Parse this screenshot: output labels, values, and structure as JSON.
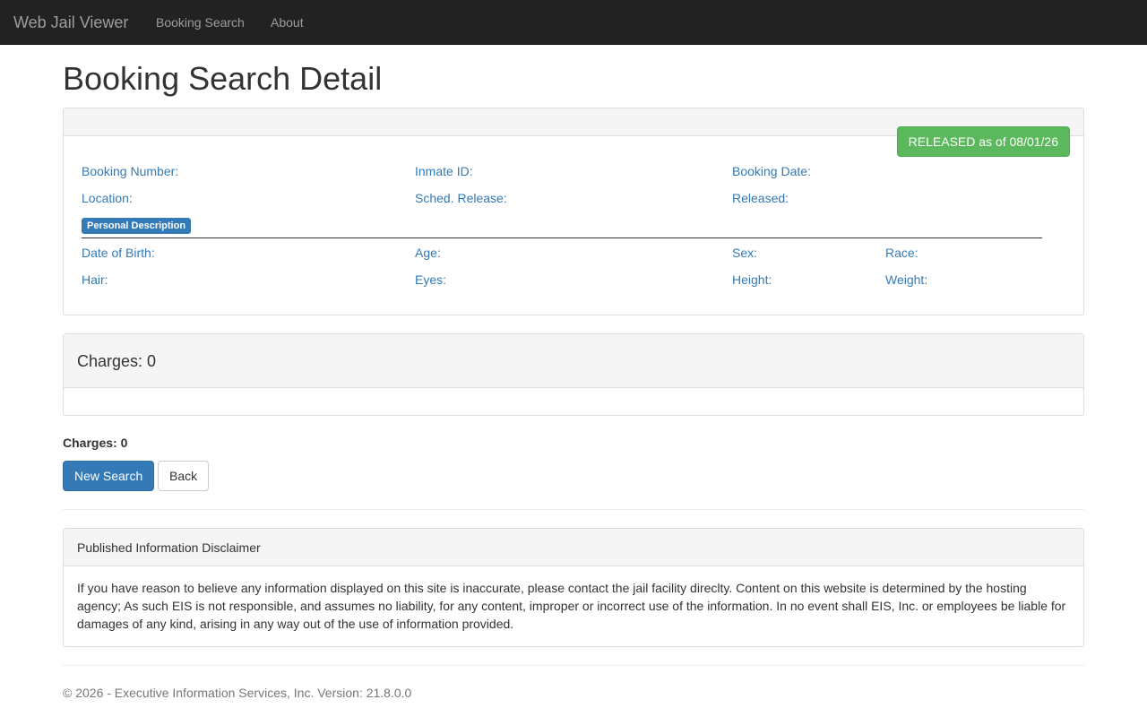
{
  "navbar": {
    "brand": "Web Jail Viewer",
    "links": [
      "Booking Search",
      "About"
    ]
  },
  "page": {
    "title": "Booking Search Detail"
  },
  "booking": {
    "status": "RELEASED as of 08/01/26",
    "status_color": "#5cb85c",
    "fields": {
      "booking_number": "Booking Number:",
      "inmate_id": "Inmate ID:",
      "booking_date": "Booking Date:",
      "location": "Location:",
      "sched_release": "Sched. Release:",
      "released": "Released:"
    },
    "personal_description_badge": "Personal Description",
    "personal": {
      "dob": "Date of Birth:",
      "age": "Age:",
      "sex": "Sex:",
      "race": "Race:",
      "hair": "Hair:",
      "eyes": "Eyes:",
      "height": "Height:",
      "weight": "Weight:"
    }
  },
  "charges": {
    "panel_heading": "Charges: 0",
    "summary": "Charges: 0"
  },
  "actions": {
    "new_search": "New Search",
    "back": "Back"
  },
  "disclaimer": {
    "title": "Published Information Disclaimer",
    "body": "If you have reason to believe any information displayed on this site is inaccurate, please contact the jail facility direclty. Content on this website is determined by the hosting agency; As such EIS is not responsible, and assumes no liability, for any content, improper or incorrect use of the information. In no event shall EIS, Inc. or employees be liable for damages of any kind, arising in any way out of the use of information provided."
  },
  "footer": {
    "text": "© 2026 - Executive Information Services, Inc. Version: 21.8.0.0"
  }
}
